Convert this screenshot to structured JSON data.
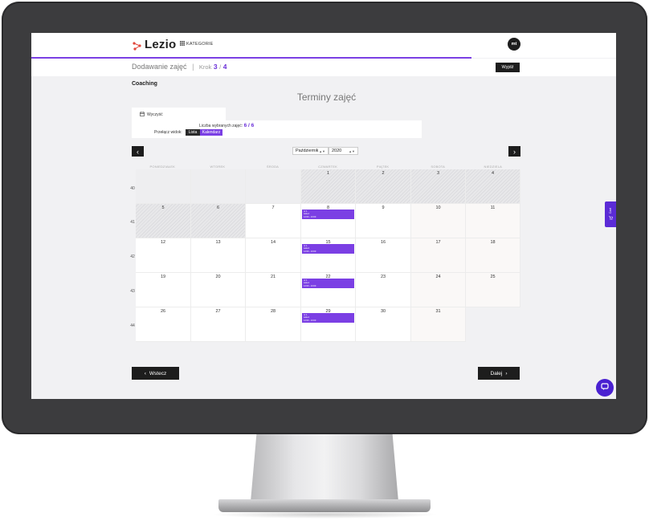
{
  "header": {
    "logo_text": "Lezio",
    "categories_label": "KATEGORIE",
    "avatar_initials": "mt"
  },
  "subheader": {
    "crumb_title": "Dodawanie zajęć",
    "step_label": "Krok",
    "step_current": "3",
    "step_sep": "/",
    "step_total": "4",
    "exit_label": "Wyjdź"
  },
  "section": {
    "name": "Coaching",
    "page_title": "Terminy zajęć"
  },
  "filters": {
    "clear_label": "Wyczyść",
    "count_label": "Liczba wybranych zajęć:",
    "count_value": "6 / 6",
    "view_label": "Przełącz widok:",
    "view_list": "Lista",
    "view_calendar": "Kalendarz"
  },
  "month_nav": {
    "prev_icon": "‹",
    "next_icon": "›",
    "month": "Październik",
    "year": "2020"
  },
  "calendar": {
    "weekdays": [
      "PONIEDZIAŁEK",
      "WTOREK",
      "ŚRODA",
      "CZWARTEK",
      "PIĄTEK",
      "SOBOTA",
      "NIEDZIELA"
    ],
    "weeks": [
      {
        "num": "40",
        "days": [
          "",
          "",
          "",
          "1",
          "2",
          "3",
          "4"
        ]
      },
      {
        "num": "41",
        "days": [
          "5",
          "6",
          "7",
          "8",
          "9",
          "10",
          "11"
        ]
      },
      {
        "num": "42",
        "days": [
          "12",
          "13",
          "14",
          "15",
          "16",
          "17",
          "18"
        ]
      },
      {
        "num": "43",
        "days": [
          "19",
          "20",
          "21",
          "22",
          "23",
          "24",
          "25"
        ]
      },
      {
        "num": "44",
        "days": [
          "26",
          "27",
          "28",
          "29",
          "30",
          "31",
          ""
        ]
      }
    ],
    "events": [
      {
        "line1": "nr 1",
        "line2": "sala A",
        "line3": "12:00 - 13:00"
      },
      {
        "line1": "nr 1",
        "line2": "sala A",
        "line3": "12:00 - 13:00"
      },
      {
        "line1": "nr 1",
        "line2": "sala A",
        "line3": "12:00 - 13:00"
      },
      {
        "line1": "nr 1",
        "line2": "sala A",
        "line3": "12:00 - 13:00"
      }
    ]
  },
  "footer": {
    "back_label": "Wstecz",
    "next_label": "Dalej"
  },
  "side": {
    "cart_label": "Cart"
  },
  "colors": {
    "accent": "#7b3fe4",
    "dark": "#1d1d1d",
    "chat": "#4a21d1"
  }
}
